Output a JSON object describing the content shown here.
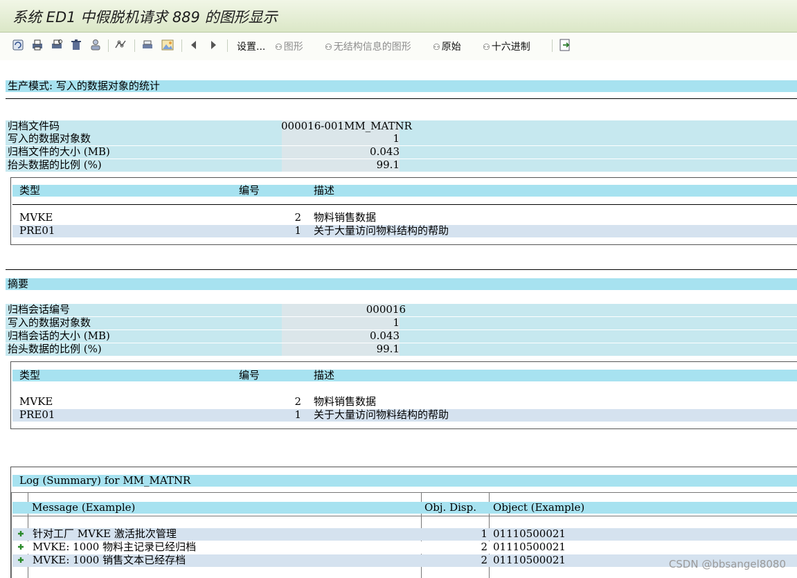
{
  "window": {
    "title": "系统 ED1 中假脱机请求 889 的图形显示"
  },
  "toolbar": {
    "settings": "设置...",
    "graphic": "图形",
    "unstructured_graphic": "无结构信息的图形",
    "original": "原始",
    "hex": "十六进制"
  },
  "section1": {
    "header": "生产模式: 写入的数据对象的统计",
    "fields": [
      {
        "label": "归档文件码",
        "value": "000016-001MM_MATNR"
      },
      {
        "label": "写入的数据对象数",
        "value": "1"
      },
      {
        "label": "归档文件的大小 (MB)",
        "value": "0.043"
      },
      {
        "label": "抬头数据的比例 (%)",
        "value": "99.1"
      }
    ],
    "table": {
      "headers": {
        "type": "类型",
        "number": "编号",
        "desc": "描述"
      },
      "rows": [
        {
          "type": "MVKE",
          "number": "2",
          "desc": "物料销售数据"
        },
        {
          "type": "PRE01",
          "number": "1",
          "desc": "关于大量访问物料结构的帮助"
        }
      ]
    }
  },
  "section2": {
    "header": "摘要",
    "fields": [
      {
        "label": "归档会话编号",
        "value": "000016"
      },
      {
        "label": "写入的数据对象数",
        "value": "1"
      },
      {
        "label": "归档会话的大小 (MB)",
        "value": "0.043"
      },
      {
        "label": "抬头数据的比例 (%)",
        "value": "99.1"
      }
    ],
    "table": {
      "headers": {
        "type": "类型",
        "number": "编号",
        "desc": "描述"
      },
      "rows": [
        {
          "type": "MVKE",
          "number": "2",
          "desc": "物料销售数据"
        },
        {
          "type": "PRE01",
          "number": "1",
          "desc": "关于大量访问物料结构的帮助"
        }
      ]
    }
  },
  "log": {
    "title": "Log (Summary) for MM_MATNR",
    "headers": {
      "message": "Message (Example)",
      "disp": "Obj. Disp.",
      "object": "Object (Example)"
    },
    "rows": [
      {
        "message": "针对工厂 MVKE 激活批次管理",
        "disp": "1",
        "object": "01110500021"
      },
      {
        "message": "MVKE: 1000 物料主记录已经归档",
        "disp": "2",
        "object": "01110500021"
      },
      {
        "message": "MVKE: 1000 销售文本已经存档",
        "disp": "2",
        "object": "01110500021"
      }
    ]
  },
  "watermark": "CSDN @bbsangel8080",
  "colors": {
    "section_band": "#a7e2f0",
    "field_row": "#c6e8ef",
    "alt_row": "#d5e2ef",
    "title_bar": "#dbe7c7"
  }
}
